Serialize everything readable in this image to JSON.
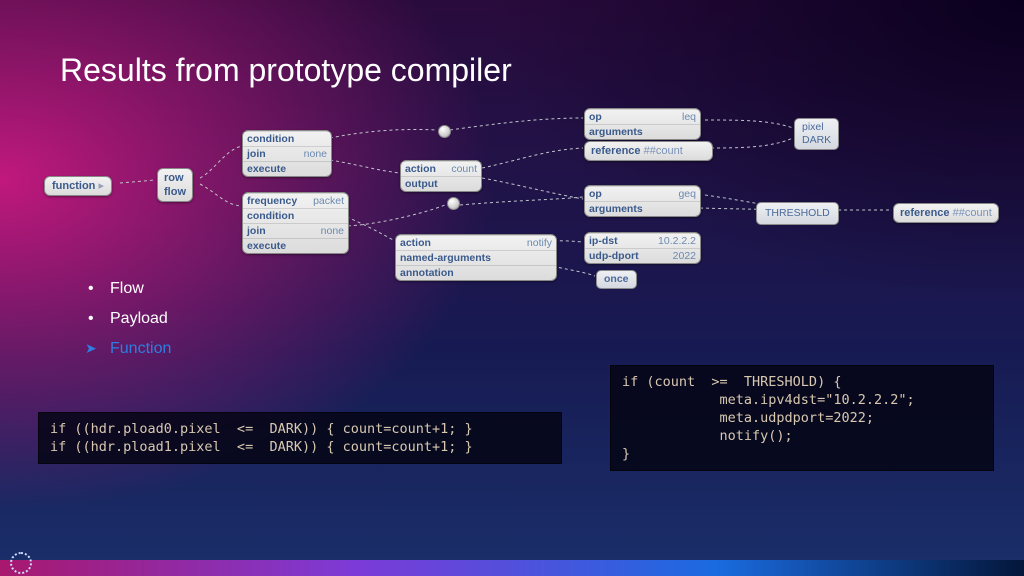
{
  "title": "Results from prototype compiler",
  "list": {
    "flow": "Flow",
    "payload": "Payload",
    "function": "Function"
  },
  "nodes": {
    "function": "function",
    "row": {
      "row": "row",
      "flow": "flow"
    },
    "block1": {
      "condition": "condition",
      "join": "join",
      "join_v": "none",
      "execute": "execute"
    },
    "block2": {
      "frequency": "frequency",
      "frequency_v": "packet",
      "condition": "condition",
      "join": "join",
      "join_v": "none",
      "execute": "execute"
    },
    "actioncount": {
      "action": "action",
      "action_v": "count",
      "output": "output"
    },
    "actionnotify": {
      "action": "action",
      "action_v": "notify",
      "named": "named-arguments",
      "annotation": "annotation"
    },
    "opleq": {
      "op": "op",
      "op_v": "leq",
      "arguments": "arguments"
    },
    "opgeq": {
      "op": "op",
      "op_v": "geq",
      "arguments": "arguments"
    },
    "ipdst": {
      "ipdst": "ip-dst",
      "ipdst_v": "10.2.2.2",
      "udp": "udp-dport",
      "udp_v": "2022"
    },
    "ref1": {
      "reference": "reference",
      "v": "##count"
    },
    "ref2": {
      "reference": "reference",
      "v": "##count"
    },
    "pixel": {
      "pixel": "pixel",
      "dark": "DARK"
    },
    "threshold": "THRESHOLD",
    "once": "once"
  },
  "code1": "if ((hdr.pload0.pixel  <=  DARK)) { count=count+1; }\nif ((hdr.pload1.pixel  <=  DARK)) { count=count+1; }",
  "code2": "if (count  >=  THRESHOLD) {\n            meta.ipv4dst=\"10.2.2.2\";\n            meta.udpdport=2022;\n            notify();\n}"
}
